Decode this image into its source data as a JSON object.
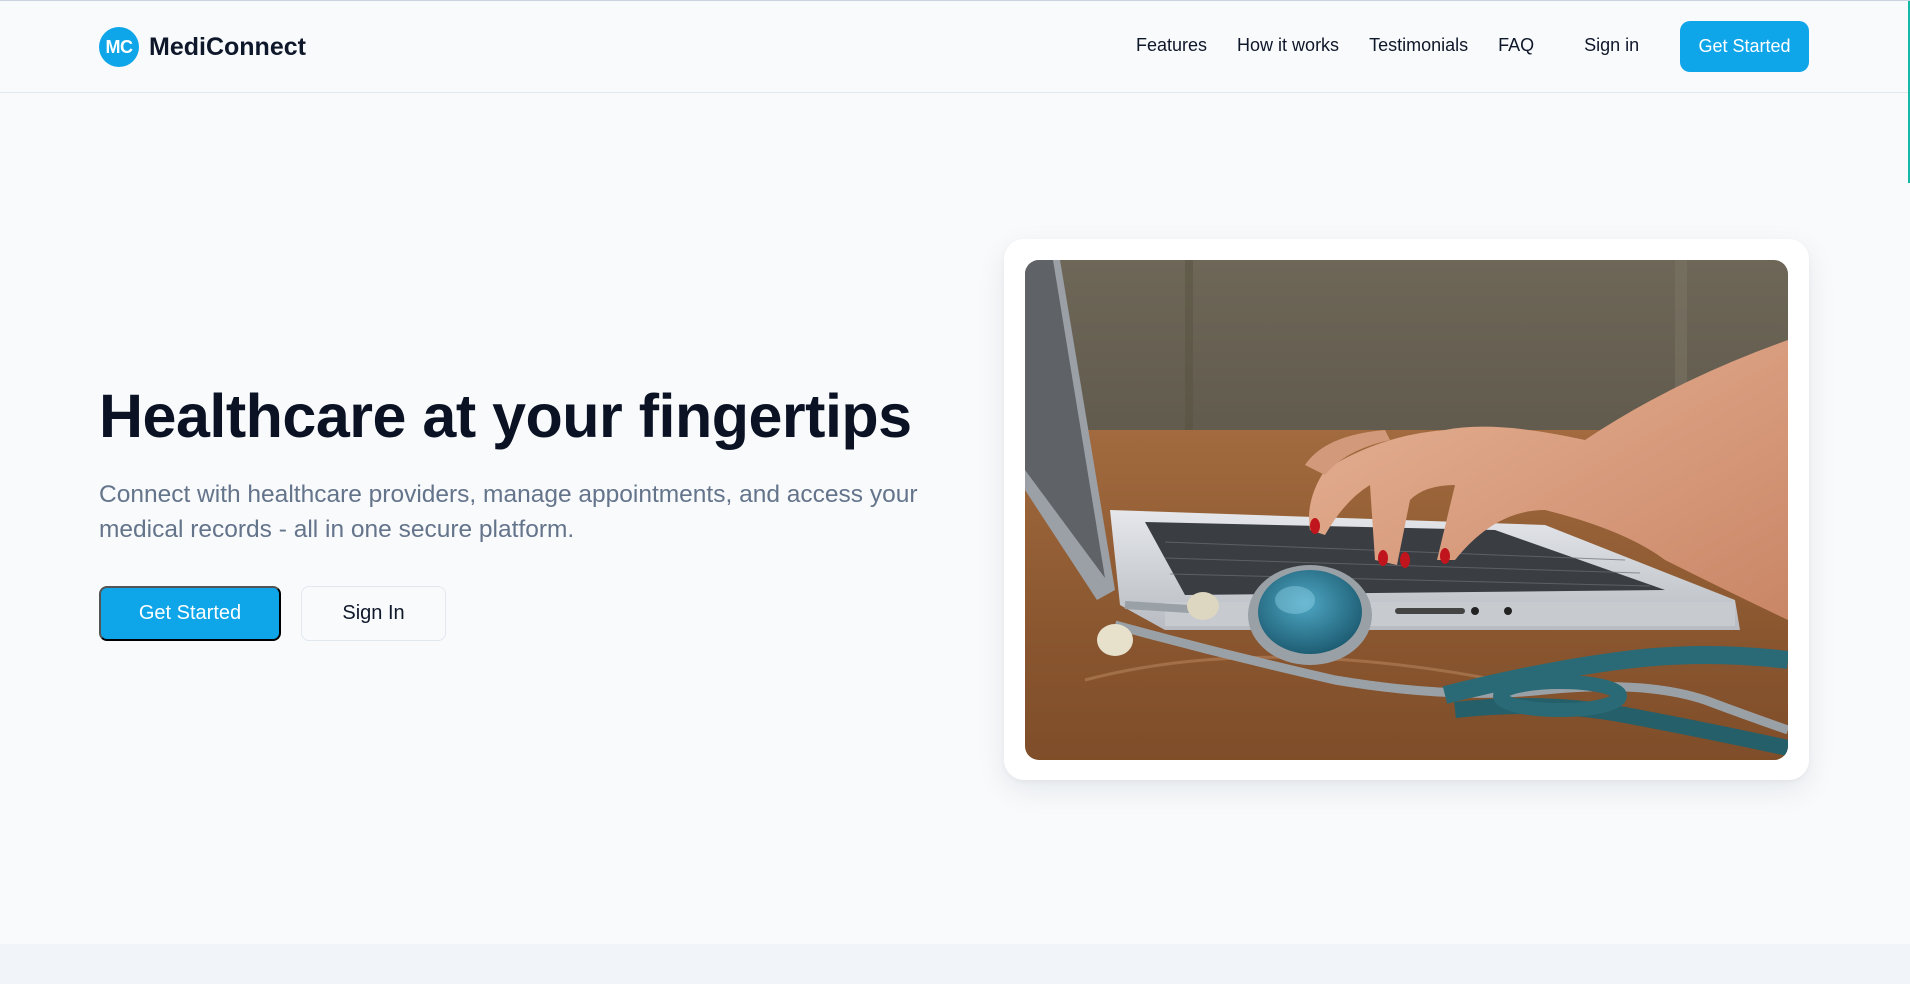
{
  "brand": {
    "logo_initials": "MC",
    "name": "MediConnect",
    "accent_color": "#0ea5e9"
  },
  "nav": {
    "items": [
      "Features",
      "How it works",
      "Testimonials",
      "FAQ"
    ],
    "sign_in": "Sign in",
    "cta": "Get Started"
  },
  "hero": {
    "title": "Healthcare at your fingertips",
    "subtitle": "Connect with healthcare providers, manage appointments, and access your medical records - all in one secure platform.",
    "primary_button": "Get Started",
    "secondary_button": "Sign In",
    "image": {
      "icon": "laptop-stethoscope-photo"
    }
  }
}
